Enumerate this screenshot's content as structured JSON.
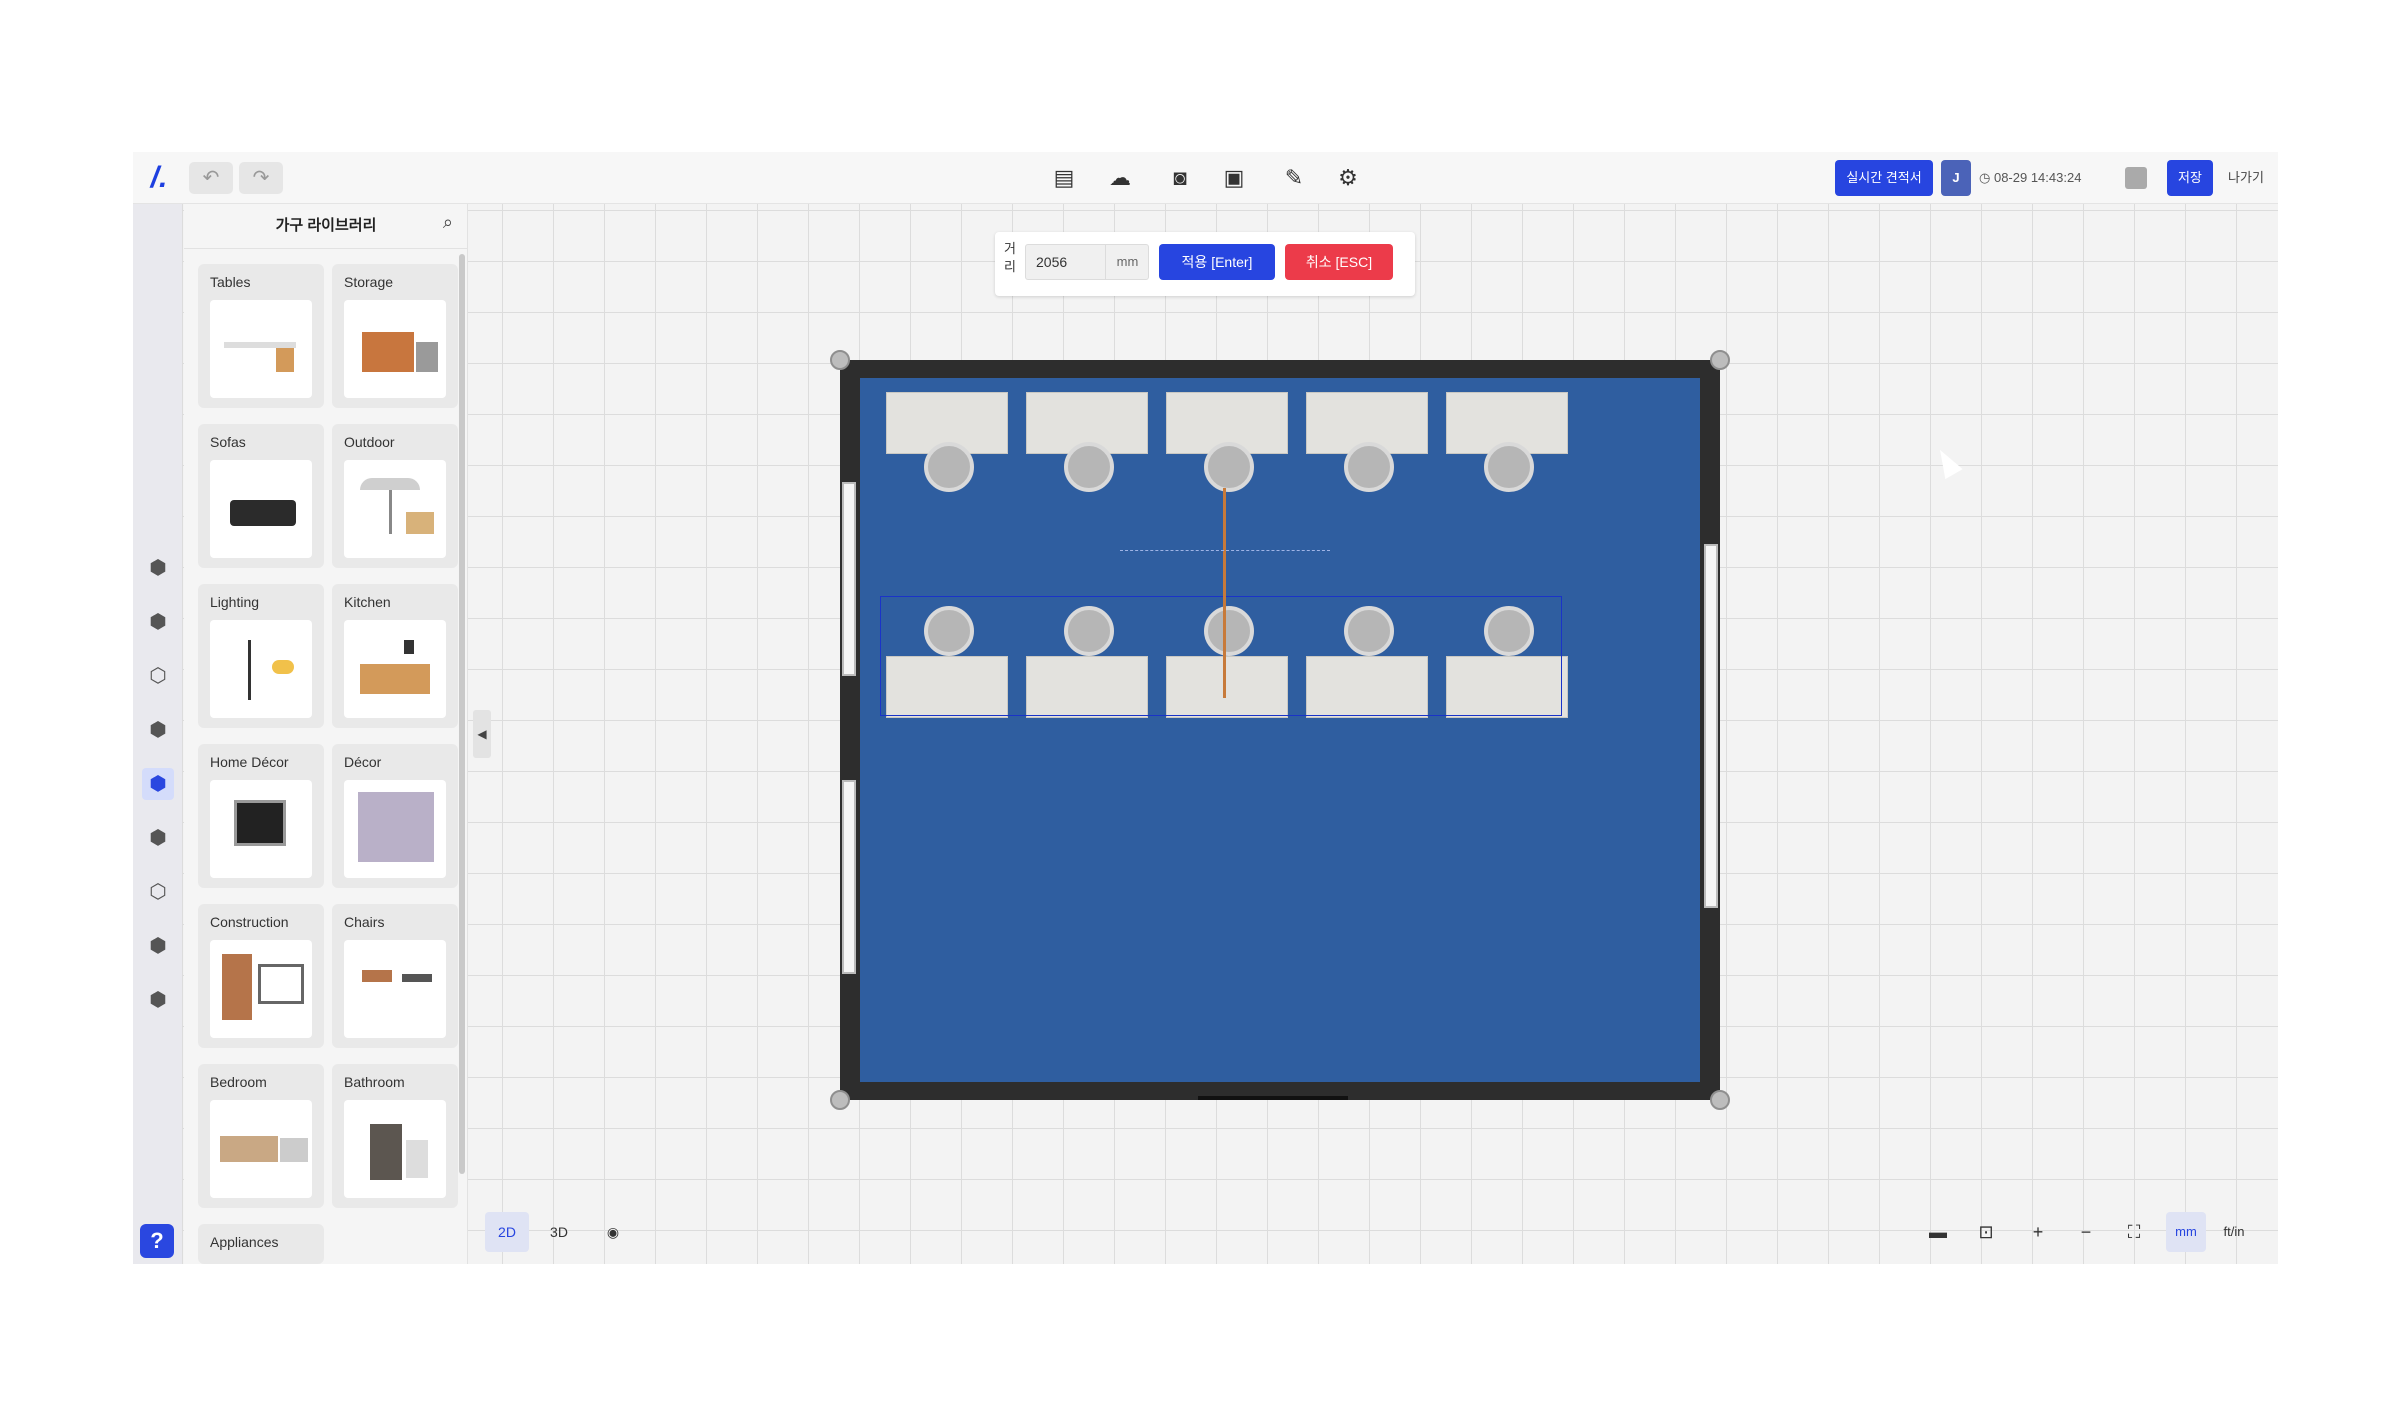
{
  "toolbar": {
    "logo": "/.",
    "undo_icon": "undo-icon",
    "redo_icon": "redo-icon",
    "tools": [
      "file-icon",
      "cloud-upload-icon",
      "camera-icon",
      "image-icon",
      "wrench-icon",
      "gear-icon"
    ],
    "estimate_label": "실시간 견적서",
    "user_initial": "J",
    "clock": "08-29 14:43:24",
    "save_label": "저장",
    "exit_label": "나가기"
  },
  "library": {
    "title": "가구 라이브러리",
    "categories": [
      {
        "label": "Tables"
      },
      {
        "label": "Storage"
      },
      {
        "label": "Sofas"
      },
      {
        "label": "Outdoor"
      },
      {
        "label": "Lighting"
      },
      {
        "label": "Kitchen"
      },
      {
        "label": "Home Décor"
      },
      {
        "label": "Décor"
      },
      {
        "label": "Construction"
      },
      {
        "label": "Chairs"
      },
      {
        "label": "Bedroom"
      },
      {
        "label": "Bathroom"
      },
      {
        "label": "Appliances"
      }
    ]
  },
  "measure": {
    "label": "거리",
    "value": "2056",
    "unit": "mm",
    "apply_label": "적용 [Enter]",
    "cancel_label": "취소 [ESC]"
  },
  "view": {
    "mode_2d": "2D",
    "mode_3d": "3D",
    "unit_mm": "mm",
    "unit_ftin": "ft/in"
  },
  "colors": {
    "accent": "#2745e0",
    "danger": "#ec3b4a",
    "floor": "#2f5ea0"
  }
}
